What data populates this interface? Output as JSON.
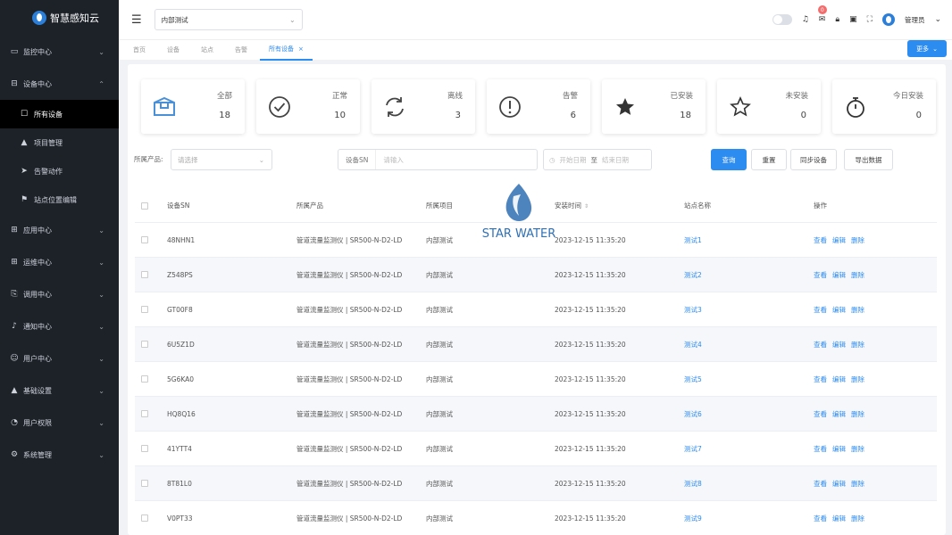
{
  "sidebar": {
    "app_name": "智慧感知云",
    "items": [
      {
        "label": "监控中心",
        "icon": "monitor-icon",
        "chevron": "⌄"
      },
      {
        "label": "设备中心",
        "icon": "device-icon",
        "chevron": "⌃"
      },
      {
        "label": "应用中心",
        "icon": "grid-icon",
        "chevron": "⌄"
      },
      {
        "label": "运维中心",
        "icon": "grid-icon",
        "chevron": "⌄"
      },
      {
        "label": "调用中心",
        "icon": "call-icon",
        "chevron": "⌄"
      },
      {
        "label": "通知中心",
        "icon": "bell-icon",
        "chevron": "⌄"
      },
      {
        "label": "用户中心",
        "icon": "user-icon",
        "chevron": "⌄"
      },
      {
        "label": "基础设置",
        "icon": "base-icon",
        "chevron": "⌄"
      },
      {
        "label": "用户权限",
        "icon": "permission-icon",
        "chevron": "⌄"
      },
      {
        "label": "系统管理",
        "icon": "gear-icon",
        "chevron": "⌄"
      }
    ],
    "sub_items": [
      {
        "label": "所有设备",
        "icon": "list-icon",
        "active": true
      },
      {
        "label": "项目管理",
        "icon": "project-icon",
        "active": false
      },
      {
        "label": "告警动作",
        "icon": "send-icon",
        "active": false
      },
      {
        "label": "站点位置编辑",
        "icon": "flag-icon",
        "active": false
      }
    ]
  },
  "topbar": {
    "project_value": "内部测试",
    "badge_count": "0",
    "user_name": "管理员"
  },
  "tabs": [
    {
      "label": "首页"
    },
    {
      "label": "设备"
    },
    {
      "label": "站点"
    },
    {
      "label": "告警"
    },
    {
      "label": "所有设备",
      "close": "×"
    }
  ],
  "more_button": "更多",
  "stats": [
    {
      "label": "全部",
      "value": "18",
      "icon": "box-icon"
    },
    {
      "label": "正常",
      "value": "10",
      "icon": "check-circle-icon"
    },
    {
      "label": "离线",
      "value": "3",
      "icon": "refresh-icon"
    },
    {
      "label": "告警",
      "value": "6",
      "icon": "alert-circle-icon"
    },
    {
      "label": "已安装",
      "value": "18",
      "icon": "star-filled-icon"
    },
    {
      "label": "未安装",
      "value": "0",
      "icon": "star-outline-icon"
    },
    {
      "label": "今日安装",
      "value": "0",
      "icon": "stopwatch-icon"
    }
  ],
  "filters": {
    "product_label": "所属产品:",
    "product_placeholder": "请选择",
    "sn_prefix": "设备SN",
    "sn_placeholder": "请输入",
    "date_start": "开始日期",
    "date_sep": "至",
    "date_end": "结束日期",
    "query": "查询",
    "reset": "重置",
    "sync": "同步设备",
    "export": "导出数据"
  },
  "watermark": "STAR WATER",
  "table": {
    "headers": {
      "sn": "设备SN",
      "product": "所属产品",
      "project": "所属项目",
      "time": "安装时间",
      "site": "站点名称",
      "ops": "操作"
    },
    "ops": {
      "view": "查看",
      "edit": "编辑",
      "delete": "删除"
    },
    "rows": [
      {
        "sn": "48NHN1",
        "product": "管道流量监测仪 | SR500-N-D2-LD",
        "project": "内部测试",
        "time": "2023-12-15 11:35:20",
        "site": "测试1"
      },
      {
        "sn": "Z548PS",
        "product": "管道流量监测仪 | SR500-N-D2-LD",
        "project": "内部测试",
        "time": "2023-12-15 11:35:20",
        "site": "测试2"
      },
      {
        "sn": "GT00F8",
        "product": "管道流量监测仪 | SR500-N-D2-LD",
        "project": "内部测试",
        "time": "2023-12-15 11:35:20",
        "site": "测试3"
      },
      {
        "sn": "6U5Z1D",
        "product": "管道流量监测仪 | SR500-N-D2-LD",
        "project": "内部测试",
        "time": "2023-12-15 11:35:20",
        "site": "测试4"
      },
      {
        "sn": "5G6KA0",
        "product": "管道流量监测仪 | SR500-N-D2-LD",
        "project": "内部测试",
        "time": "2023-12-15 11:35:20",
        "site": "测试5"
      },
      {
        "sn": "HQ8Q16",
        "product": "管道流量监测仪 | SR500-N-D2-LD",
        "project": "内部测试",
        "time": "2023-12-15 11:35:20",
        "site": "测试6"
      },
      {
        "sn": "41YTT4",
        "product": "管道流量监测仪 | SR500-N-D2-LD",
        "project": "内部测试",
        "time": "2023-12-15 11:35:20",
        "site": "测试7"
      },
      {
        "sn": "8T81L0",
        "product": "管道流量监测仪 | SR500-N-D2-LD",
        "project": "内部测试",
        "time": "2023-12-15 11:35:20",
        "site": "测试8"
      },
      {
        "sn": "V0PT33",
        "product": "管道流量监测仪 | SR500-N-D2-LD",
        "project": "内部测试",
        "time": "2023-12-15 11:35:20",
        "site": "测试9"
      }
    ]
  },
  "colors": {
    "sidebar_bg": "#1d2229",
    "accent": "#2d8cf0",
    "active_bg": "#000000"
  }
}
